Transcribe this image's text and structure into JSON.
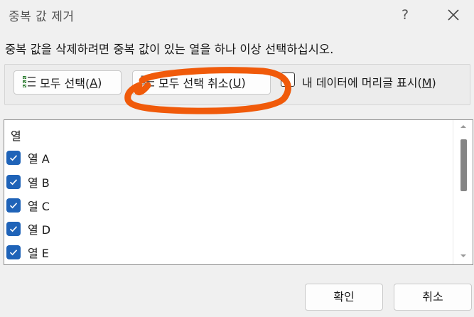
{
  "window": {
    "title": "중복 값 제거",
    "help_label": "?"
  },
  "instruction": "중복 값을 삭제하려면 중복 값이 있는 열을 하나 이상 선택하십시오.",
  "options": {
    "select_all": {
      "text": "모두 선택(",
      "key": "A",
      "close": ")"
    },
    "unselect_all": {
      "text": "모두 선택 취소(",
      "key": "U",
      "close": ")"
    },
    "header_checkbox": {
      "text": "내 데이터에 머리글 표시(",
      "key": "M",
      "close": ")",
      "checked": false
    }
  },
  "list": {
    "header": "열",
    "items": [
      {
        "label": "열 A",
        "checked": true
      },
      {
        "label": "열 B",
        "checked": true
      },
      {
        "label": "열 C",
        "checked": true
      },
      {
        "label": "열 D",
        "checked": true
      },
      {
        "label": "열 E",
        "checked": true
      }
    ]
  },
  "footer": {
    "ok_label": "확인",
    "cancel_label": "취소"
  },
  "colors": {
    "checkbox_blue": "#1f63b8",
    "annotation_orange": "#f05a0a"
  },
  "annotation": {
    "shape": "hand-drawn circle",
    "target": "unselect-all-button"
  }
}
